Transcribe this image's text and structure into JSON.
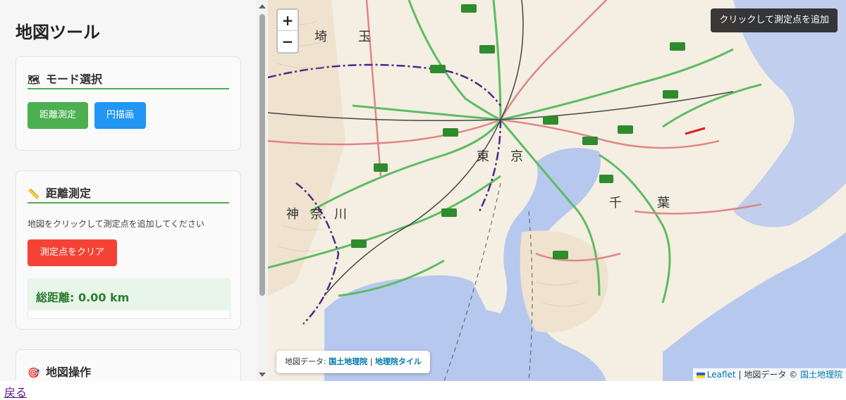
{
  "sidebar": {
    "title": "地図ツール",
    "mode_card": {
      "icon": "map-icon",
      "heading": "モード選択",
      "buttons": [
        "距離測定",
        "円描画"
      ]
    },
    "distance_card": {
      "icon": "ruler-icon",
      "heading": "距離測定",
      "description": "地図をクリックして測定点を追加してください",
      "clear_button": "測定点をクリア",
      "total": "総距離: 0.00 km"
    },
    "ops_card": {
      "icon": "target-icon",
      "heading": "地図操作"
    }
  },
  "map": {
    "zoom_in": "+",
    "zoom_out": "−",
    "tooltip": "クリックして測定点を追加",
    "attribution": {
      "prefix": "地図データ:",
      "link1": "国土地理院",
      "separator": "|",
      "link2": "地理院タイル"
    },
    "leaflet_attr": {
      "link": "Leaflet",
      "text": "| 地図データ ©",
      "link2": "国土地理院"
    },
    "labels": {
      "saitama1": "埼",
      "saitama2": "玉",
      "tokyo1": "東",
      "tokyo2": "京",
      "kanagawa1": "神",
      "kanagawa2": "奈",
      "kanagawa3": "川",
      "chiba1": "千",
      "chiba2": "葉"
    },
    "colors": {
      "water": "#b7c8ef",
      "land": "#f4efe2",
      "road_green": "#5dbb63",
      "road_red": "#e08585",
      "route_badge": "#2e8b2e"
    }
  },
  "footer": {
    "back_link": "戻る"
  },
  "colors": {
    "mode_green": "#4caf50",
    "mode_blue": "#2196f3",
    "clear_red": "#f44336"
  }
}
